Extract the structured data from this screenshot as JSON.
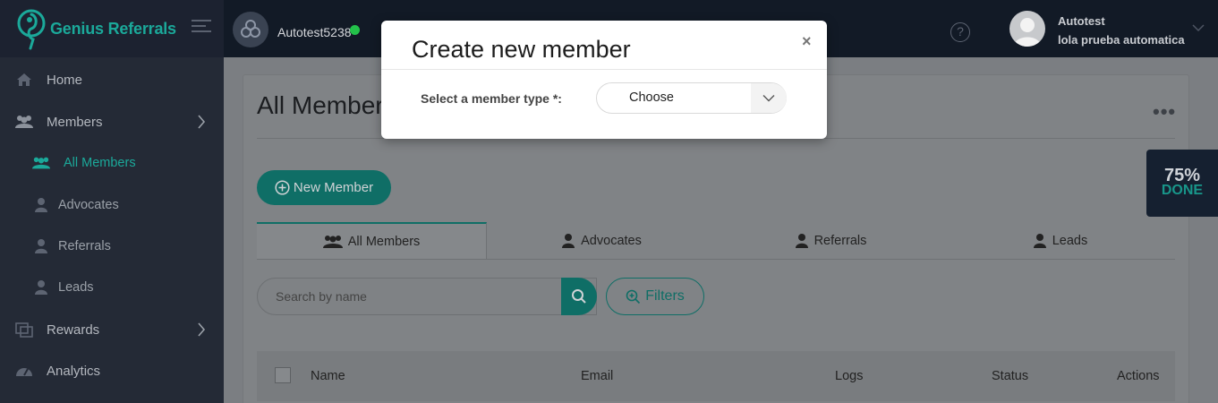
{
  "brand": {
    "name": "Genius Referrals"
  },
  "sidebar": {
    "items": [
      {
        "label": "Home",
        "icon": "home-icon"
      },
      {
        "label": "Members",
        "icon": "members-icon"
      },
      {
        "label": "Rewards",
        "icon": "rewards-icon"
      },
      {
        "label": "Analytics",
        "icon": "analytics-icon"
      }
    ],
    "sub_items": [
      {
        "label": "All Members",
        "icon": "group-icon",
        "active": true
      },
      {
        "label": "Advocates",
        "icon": "user-icon"
      },
      {
        "label": "Referrals",
        "icon": "user-icon"
      },
      {
        "label": "Leads",
        "icon": "user-icon"
      }
    ]
  },
  "topbar": {
    "account_name": "Autotest5238",
    "status_color": "#23c14a",
    "help_glyph": "?",
    "user_name": "Autotest",
    "user_subtitle": "lola prueba automatica"
  },
  "page": {
    "title": "All Members",
    "more_glyph": "•••",
    "new_button_label": "New Member",
    "tabs": [
      "All Members",
      "Advocates",
      "Referrals",
      "Leads"
    ],
    "search_placeholder": "Search by name",
    "filters_label": "Filters",
    "table_headers": [
      "Name",
      "Email",
      "Logs",
      "Status",
      "Actions"
    ]
  },
  "progress": {
    "percent_label": "75%",
    "done_label": "DONE",
    "percent": 75
  },
  "modal": {
    "title": "Create new member",
    "close_glyph": "×",
    "field_label": "Select a member type *:",
    "select_value": "Choose"
  },
  "colors": {
    "accent": "#1ba99a",
    "sidebar": "#242a36",
    "topbar": "#121a26"
  }
}
